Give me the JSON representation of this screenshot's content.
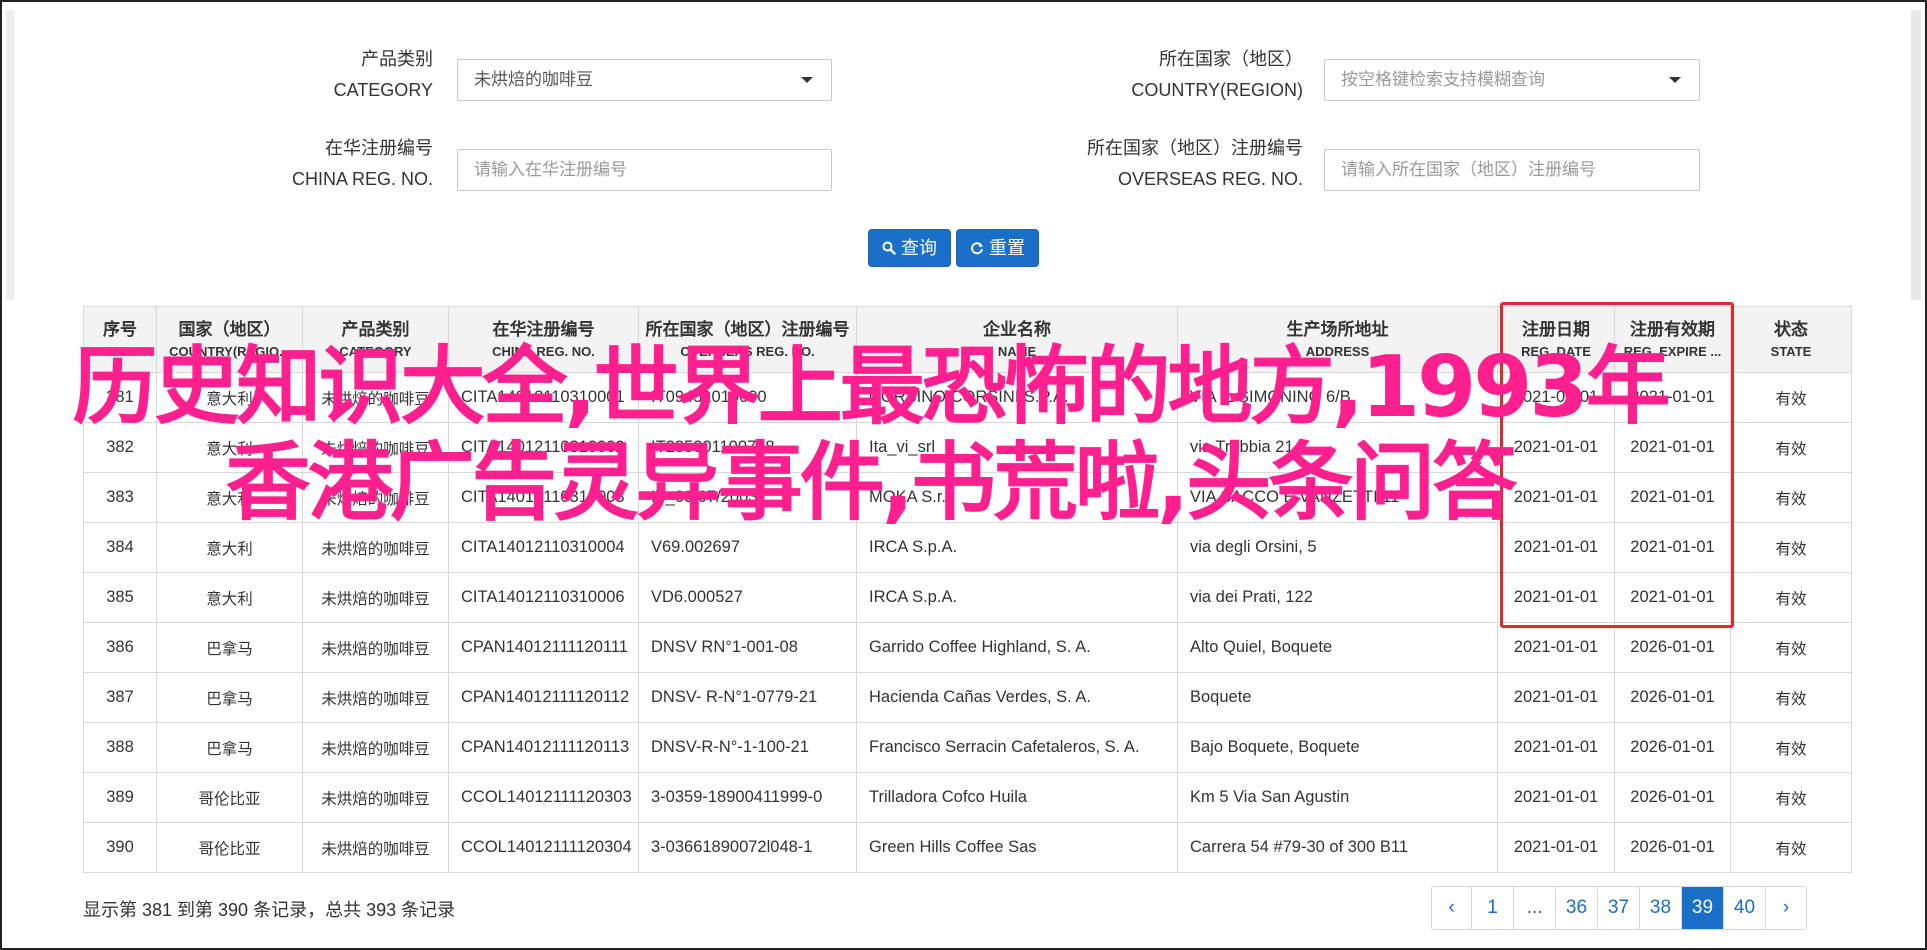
{
  "filters": {
    "category": {
      "label_zh": "产品类别",
      "label_en": "CATEGORY",
      "value": "未烘焙的咖啡豆"
    },
    "country": {
      "label_zh": "所在国家（地区）",
      "label_en": "COUNTRY(REGION)",
      "placeholder": "按空格键检索支持模糊查询"
    },
    "china_reg": {
      "label_zh": "在华注册编号",
      "label_en": "CHINA REG. NO.",
      "placeholder": "请输入在华注册编号"
    },
    "overseas_reg": {
      "label_zh": "所在国家（地区）注册编号",
      "label_en": "OVERSEAS REG. NO.",
      "placeholder": "请输入所在国家（地区）注册编号"
    }
  },
  "buttons": {
    "search": "查询",
    "reset": "重置"
  },
  "table": {
    "headers": [
      {
        "zh": "序号",
        "en": "NO."
      },
      {
        "zh": "国家（地区）",
        "en": "COUNTRY(REGIO..."
      },
      {
        "zh": "产品类别",
        "en": "CATEGORY"
      },
      {
        "zh": "在华注册编号",
        "en": "CHINA REG. NO."
      },
      {
        "zh": "所在国家（地区）注册编号",
        "en": "OVERSEAS REG. NO."
      },
      {
        "zh": "企业名称",
        "en": "NAME"
      },
      {
        "zh": "生产场所地址",
        "en": "ADDRESS"
      },
      {
        "zh": "注册日期",
        "en": "REG. DATE"
      },
      {
        "zh": "注册有效期",
        "en": "REG. EXPIRE ..."
      },
      {
        "zh": "状态",
        "en": "STATE"
      }
    ],
    "rows": [
      [
        "381",
        "意大利",
        "未烘焙的咖啡豆",
        "CITA14012110310001",
        "IT09451010000",
        "CORSINO CORSINI S.P.A.",
        "VIA IL SIMONINO 6/B",
        "2021-01-01",
        "2021-01-01",
        "有效"
      ],
      [
        "382",
        "意大利",
        "未烘焙的咖啡豆",
        "CITA14012110310002",
        "IT285001100718",
        "Ita_vi_srl",
        "via Trebbia 21",
        "2021-01-01",
        "2021-01-01",
        "有效"
      ],
      [
        "383",
        "意大利",
        "未烘焙的咖啡豆",
        "CITA14012110310003",
        "IT_09/07/2003",
        "MOKA S.r.l.",
        "VIA SACCO E VANZETTI 11",
        "2021-01-01",
        "2021-01-01",
        "有效"
      ],
      [
        "384",
        "意大利",
        "未烘焙的咖啡豆",
        "CITA14012110310004",
        "V69.002697",
        "IRCA S.p.A.",
        "via degli Orsini, 5",
        "2021-01-01",
        "2021-01-01",
        "有效"
      ],
      [
        "385",
        "意大利",
        "未烘焙的咖啡豆",
        "CITA14012110310006",
        "VD6.000527",
        "IRCA S.p.A.",
        "via dei Prati, 122",
        "2021-01-01",
        "2021-01-01",
        "有效"
      ],
      [
        "386",
        "巴拿马",
        "未烘焙的咖啡豆",
        "CPAN14012111120111",
        "DNSV RN°1-001-08",
        "Garrido Coffee Highland, S. A.",
        "Alto Quiel, Boquete",
        "2021-01-01",
        "2026-01-01",
        "有效"
      ],
      [
        "387",
        "巴拿马",
        "未烘焙的咖啡豆",
        "CPAN14012111120112",
        "DNSV- R-N°1-0779-21",
        "Hacienda Cañas Verdes, S. A.",
        "Boquete",
        "2021-01-01",
        "2026-01-01",
        "有效"
      ],
      [
        "388",
        "巴拿马",
        "未烘焙的咖啡豆",
        "CPAN14012111120113",
        "DNSV-R-N°-1-100-21",
        "Francisco Serracin Cafetaleros, S. A.",
        "Bajo Boquete, Boquete",
        "2021-01-01",
        "2026-01-01",
        "有效"
      ],
      [
        "389",
        "哥伦比亚",
        "未烘焙的咖啡豆",
        "CCOL14012111120303",
        "3-0359-18900411999-0",
        "Trilladora Cofco Huila",
        "Km 5 Via San Agustin",
        "2021-01-01",
        "2026-01-01",
        "有效"
      ],
      [
        "390",
        "哥伦比亚",
        "未烘焙的咖啡豆",
        "CCOL14012111120304",
        "3-03661890072l048-1",
        "Green Hills Coffee Sas",
        "Carrera 54 #79-30 of 300 B11",
        "2021-01-01",
        "2026-01-01",
        "有效"
      ]
    ]
  },
  "footer": {
    "summary": "显示第 381 到第 390 条记录，总共 393 条记录"
  },
  "pagination": {
    "items": [
      "‹",
      "1",
      "...",
      "36",
      "37",
      "38",
      "39",
      "40",
      "›"
    ],
    "active": "39"
  },
  "overlay": {
    "caption": "历史知识大全,世界上最恐怖的地方,1993年香港广告灵异事件,书荒啦,头条问答"
  },
  "colors": {
    "primary": "#1a6fc9",
    "highlight": "#e0292b",
    "overlay_text": "#ff1f8e"
  }
}
